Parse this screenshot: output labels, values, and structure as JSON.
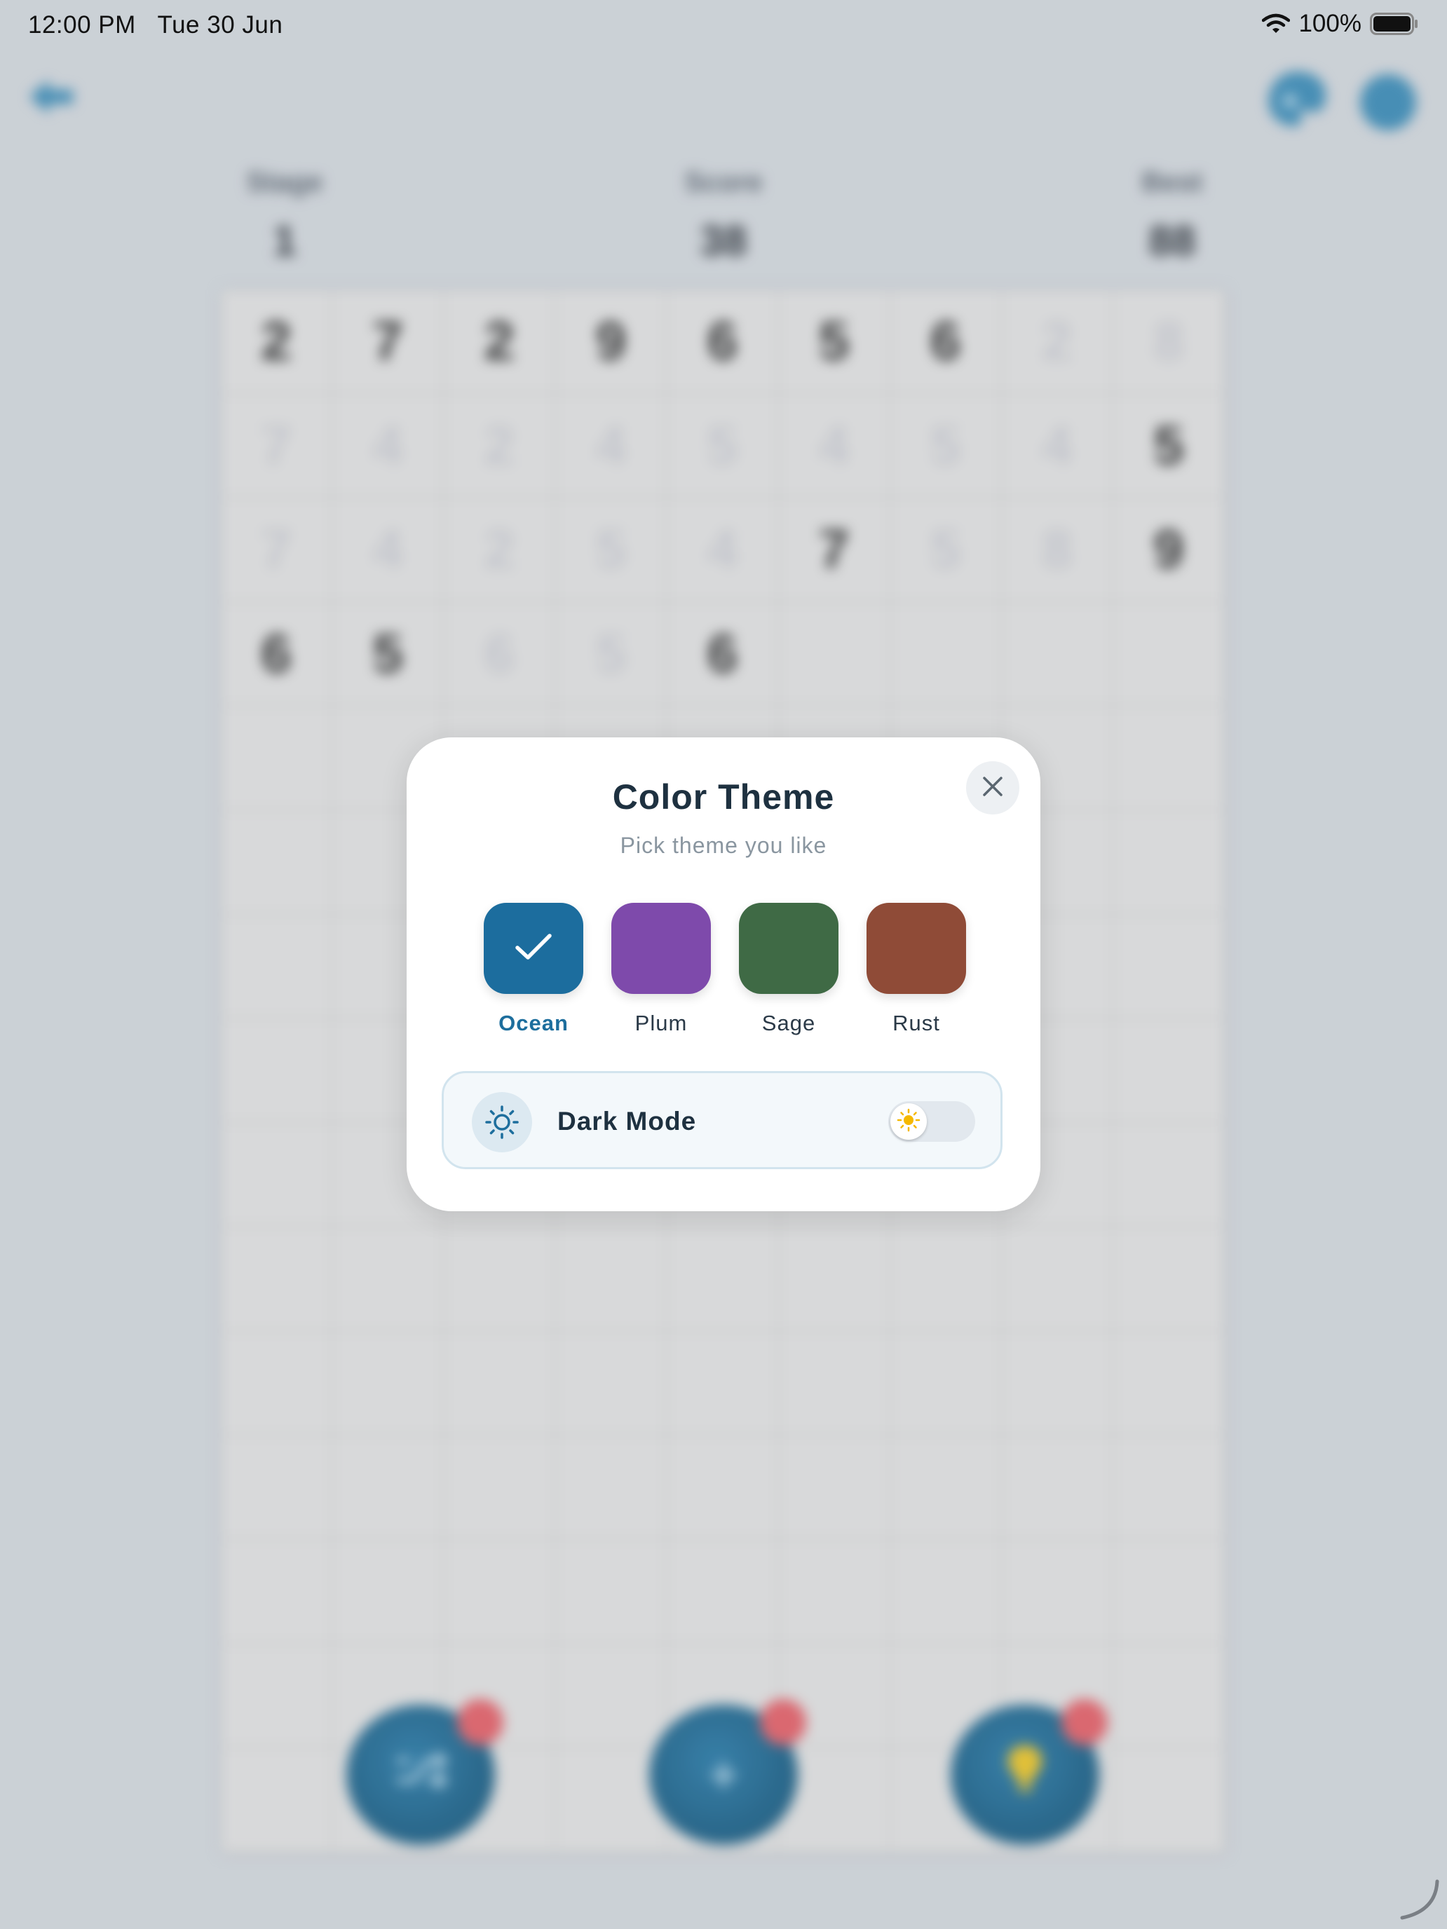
{
  "status_bar": {
    "time": "12:00 PM",
    "date": "Tue 30 Jun",
    "battery": "100%"
  },
  "header": {
    "stats": [
      {
        "label": "Stage",
        "value": "1"
      },
      {
        "label": "Score",
        "value": "38"
      },
      {
        "label": "Best",
        "value": "88"
      }
    ]
  },
  "board": {
    "rows": [
      [
        "2",
        "7",
        "2",
        "9",
        "6",
        "5",
        "6",
        "2",
        "8"
      ],
      [
        "7",
        "4",
        "2",
        "4",
        "5",
        "4",
        "5",
        "4",
        "5"
      ],
      [
        "7",
        "4",
        "2",
        "5",
        "4",
        "7",
        "5",
        "8",
        "9"
      ],
      [
        "6",
        "5",
        "6",
        "5",
        "6",
        "",
        "",
        "",
        ""
      ]
    ],
    "faded": [
      [
        false,
        false,
        false,
        false,
        false,
        false,
        false,
        true,
        true
      ],
      [
        true,
        true,
        true,
        true,
        true,
        true,
        true,
        true,
        false
      ],
      [
        true,
        true,
        true,
        true,
        true,
        false,
        true,
        true,
        false
      ],
      [
        false,
        false,
        true,
        true,
        false,
        false,
        false,
        false,
        false
      ]
    ]
  },
  "actions": [
    {
      "name": "shuffle-button"
    },
    {
      "name": "add-button",
      "label": "+"
    },
    {
      "name": "hint-button"
    }
  ],
  "modal": {
    "title": "Color Theme",
    "subtitle": "Pick theme you like",
    "themes": [
      {
        "name": "Ocean",
        "color": "#1c6d9e",
        "selected": true
      },
      {
        "name": "Plum",
        "color": "#7e4aab",
        "selected": false
      },
      {
        "name": "Sage",
        "color": "#3f6a45",
        "selected": false
      },
      {
        "name": "Rust",
        "color": "#8f4b37",
        "selected": false
      }
    ],
    "dark_mode": {
      "label": "Dark Mode",
      "enabled": false
    }
  },
  "colors": {
    "accent": "#1d6e9d",
    "title": "#1e3140",
    "toggle_sun": "#f5b800"
  }
}
